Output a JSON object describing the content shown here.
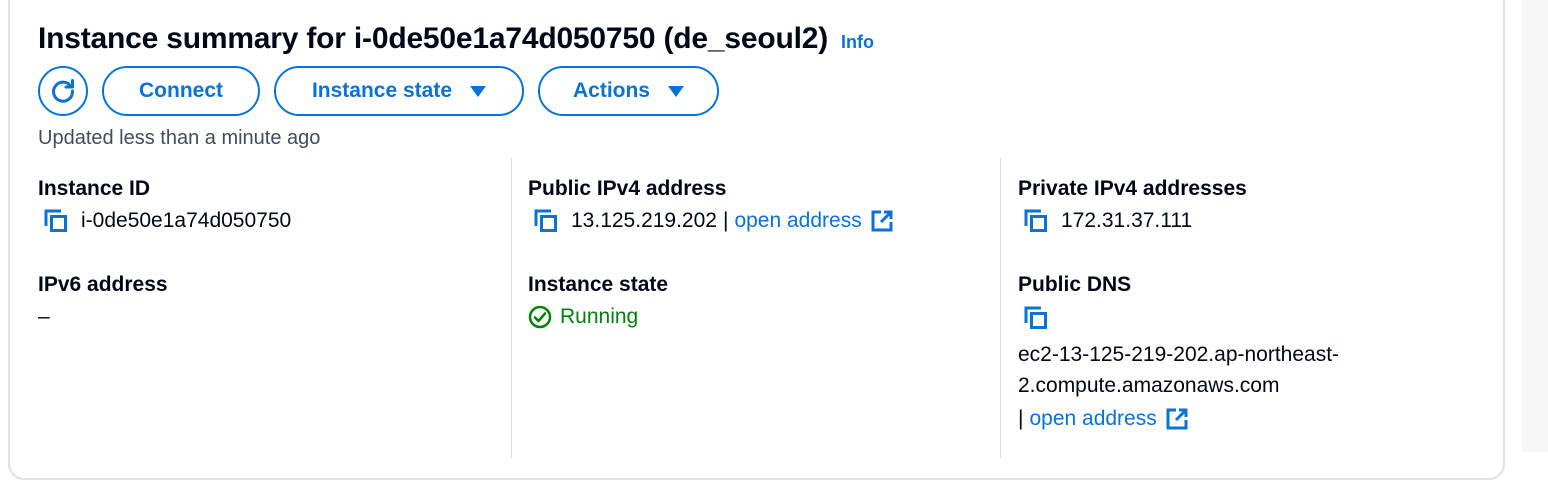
{
  "header": {
    "title": "Instance summary for i-0de50e1a74d050750 (de_seoul2)",
    "info_label": "Info"
  },
  "toolbar": {
    "refresh_icon": "refresh-icon",
    "connect_label": "Connect",
    "instance_state_label": "Instance state",
    "actions_label": "Actions"
  },
  "updated_text": "Updated less than a minute ago",
  "fields": {
    "instance_id": {
      "label": "Instance ID",
      "value": "i-0de50e1a74d050750"
    },
    "ipv6": {
      "label": "IPv6 address",
      "value": "–"
    },
    "public_ipv4": {
      "label": "Public IPv4 address",
      "value": "13.125.219.202",
      "separator": "|",
      "link_label": "open address"
    },
    "instance_state": {
      "label": "Instance state",
      "value": "Running"
    },
    "private_ipv4": {
      "label": "Private IPv4 addresses",
      "value": "172.31.37.111"
    },
    "public_dns": {
      "label": "Public DNS",
      "value_line1": "ec2-13-125-219-202.ap-northeast-",
      "value_line2": "2.compute.amazonaws.com",
      "separator": "|",
      "link_label": "open address"
    }
  },
  "colors": {
    "link": "#0972d3",
    "success": "#037f0c",
    "text": "#000716",
    "muted": "#414d5c",
    "border": "#e0e1e3"
  }
}
